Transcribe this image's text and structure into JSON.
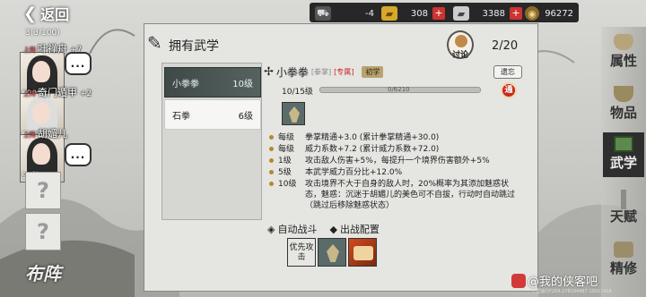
{
  "topbar": {
    "back_label": "返回",
    "resources": [
      {
        "icon": "cart-icon",
        "value": "-4"
      },
      {
        "icon": "gold-ingot-icon",
        "value": "308"
      },
      {
        "icon": "silver-ingot-icon",
        "value": "3388"
      },
      {
        "icon": "coin-icon",
        "value": "96272"
      }
    ]
  },
  "party": {
    "count": "3(3/100)",
    "members": [
      {
        "tag": "上阵",
        "name": "叶禅舟",
        "bonus": "+7",
        "level": "699级",
        "chat": "..."
      },
      {
        "tag": "上阵",
        "name": "奇门遁甲",
        "bonus": "+2",
        "level": "699级",
        "chat": ""
      },
      {
        "tag": "上阵",
        "name": "胡媚儿",
        "bonus": "",
        "level": "96级",
        "chat": "..."
      }
    ],
    "empty_slots": [
      "?",
      "?"
    ],
    "formation_label": "布阵"
  },
  "panel": {
    "title": "拥有武学",
    "discuss_label": "讨论",
    "page": "2/20"
  },
  "skills": [
    {
      "name": "小拳拳",
      "level": "10级"
    },
    {
      "name": "石拳",
      "level": "6级"
    }
  ],
  "detail": {
    "name": "小拳拳",
    "type": "[拳掌]",
    "exclusive": "[专属]",
    "grade": "初学",
    "forget_label": "遗忘",
    "level_text": "10/15级",
    "exp_text": "0/6210",
    "upgrade_label": "通",
    "effects": [
      {
        "lv": "每级",
        "text": "拳掌精通+3.0 (累计拳掌精通+30.0)"
      },
      {
        "lv": "每级",
        "text": "威力系数+7.2 (累计威力系数+72.0)"
      },
      {
        "lv": "1级",
        "text": "攻击敌人伤害+5%，每提升一个境界伤害额外+5%"
      },
      {
        "lv": "5级",
        "text": "本武学威力百分比+12.0%"
      },
      {
        "lv": "10级",
        "text": "攻击境界不大于自身的敌人时，20%概率为其添加魅惑状态，魅惑：沉迷于胡媚儿的美色可不自拔，行动时自动跳过（跳过后移除魅惑状态）"
      }
    ],
    "auto_battle_label": "自动战斗",
    "battle_config_label": "出战配置",
    "priority_label": "优先攻击"
  },
  "rnav": [
    {
      "label": "属性",
      "icon": "pot-icon",
      "active": false
    },
    {
      "label": "物品",
      "icon": "cup-icon",
      "active": false
    },
    {
      "label": "武学",
      "icon": "book-icon",
      "active": true
    },
    {
      "label": "天赋",
      "icon": "blade-icon",
      "active": false
    },
    {
      "label": "精修",
      "icon": "scroll-icon",
      "active": false
    }
  ],
  "watermark": {
    "text": "@我的侠客吧",
    "small": "千里独行F204:278194487 10011416"
  }
}
